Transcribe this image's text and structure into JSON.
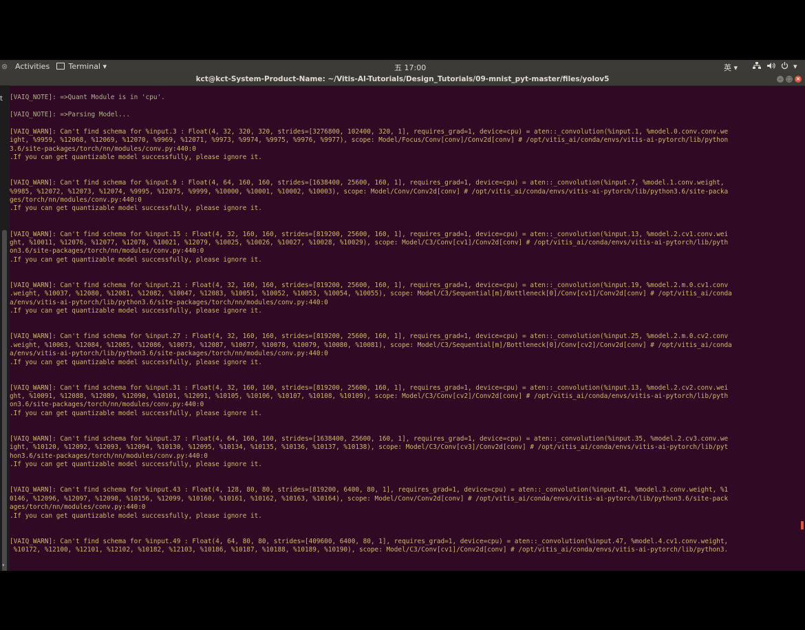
{
  "topbar": {
    "activities": "Activities",
    "app_menu": "Terminal ▾",
    "clock": "五 17:00",
    "input_method": "英 ▾"
  },
  "window": {
    "title": "kct@kct-System-Product-Name: ~/Vitis-AI-Tutorials/Design_Tutorials/09-mnist_pyt-master/files/yolov5"
  },
  "left_glyph": "t",
  "terminal": {
    "lines": [
      {
        "t": "",
        "k": "n"
      },
      {
        "t": "[VAIQ_NOTE]: =>Quant Module is in 'cpu'.",
        "k": "note"
      },
      {
        "t": "",
        "k": "n"
      },
      {
        "t": "[VAIQ_NOTE]: =>Parsing Model...",
        "k": "note"
      },
      {
        "t": "",
        "k": "n"
      },
      {
        "t": "[VAIQ_WARN]: Can't find schema for %input.3 : Float(4, 32, 320, 320, strides=[3276800, 102400, 320, 1], requires_grad=1, device=cpu) = aten::_convolution(%input.1, %model.0.conv.conv.we",
        "k": "warn"
      },
      {
        "t": "ight, %9959, %12068, %12069, %12070, %9969, %12071, %9973, %9974, %9975, %9976, %9977), scope: Model/Focus/Conv[conv]/Conv2d[conv] # /opt/vitis_ai/conda/envs/vitis-ai-pytorch/lib/python",
        "k": "warn"
      },
      {
        "t": "3.6/site-packages/torch/nn/modules/conv.py:440:0",
        "k": "warn"
      },
      {
        "t": ".If you can get quantizable model successfully, please ignore it.",
        "k": "warn"
      },
      {
        "t": "",
        "k": "n"
      },
      {
        "t": "",
        "k": "n"
      },
      {
        "t": "[VAIQ_WARN]: Can't find schema for %input.9 : Float(4, 64, 160, 160, strides=[1638400, 25600, 160, 1], requires_grad=1, device=cpu) = aten::_convolution(%input.7, %model.1.conv.weight,",
        "k": "warn"
      },
      {
        "t": "%9985, %12072, %12073, %12074, %9995, %12075, %9999, %10000, %10001, %10002, %10003), scope: Model/Conv/Conv2d[conv] # /opt/vitis_ai/conda/envs/vitis-ai-pytorch/lib/python3.6/site-packa",
        "k": "warn"
      },
      {
        "t": "ges/torch/nn/modules/conv.py:440:0",
        "k": "warn"
      },
      {
        "t": ".If you can get quantizable model successfully, please ignore it.",
        "k": "warn"
      },
      {
        "t": "",
        "k": "n"
      },
      {
        "t": "",
        "k": "n"
      },
      {
        "t": "[VAIQ_WARN]: Can't find schema for %input.15 : Float(4, 32, 160, 160, strides=[819200, 25600, 160, 1], requires_grad=1, device=cpu) = aten::_convolution(%input.13, %model.2.cv1.conv.wei",
        "k": "warn"
      },
      {
        "t": "ght, %10011, %12076, %12077, %12078, %10021, %12079, %10025, %10026, %10027, %10028, %10029), scope: Model/C3/Conv[cv1]/Conv2d[conv] # /opt/vitis_ai/conda/envs/vitis-ai-pytorch/lib/pyth",
        "k": "warn"
      },
      {
        "t": "on3.6/site-packages/torch/nn/modules/conv.py:440:0",
        "k": "warn"
      },
      {
        "t": ".If you can get quantizable model successfully, please ignore it.",
        "k": "warn"
      },
      {
        "t": "",
        "k": "n"
      },
      {
        "t": "",
        "k": "n"
      },
      {
        "t": "[VAIQ_WARN]: Can't find schema for %input.21 : Float(4, 32, 160, 160, strides=[819200, 25600, 160, 1], requires_grad=1, device=cpu) = aten::_convolution(%input.19, %model.2.m.0.cv1.conv",
        "k": "warn"
      },
      {
        "t": ".weight, %10037, %12080, %12081, %12082, %10047, %12083, %10051, %10052, %10053, %10054, %10055), scope: Model/C3/Sequential[m]/Bottleneck[0]/Conv[cv1]/Conv2d[conv] # /opt/vitis_ai/conda",
        "k": "warn"
      },
      {
        "t": "a/envs/vitis-ai-pytorch/lib/python3.6/site-packages/torch/nn/modules/conv.py:440:0",
        "k": "warn"
      },
      {
        "t": ".If you can get quantizable model successfully, please ignore it.",
        "k": "warn"
      },
      {
        "t": "",
        "k": "n"
      },
      {
        "t": "",
        "k": "n"
      },
      {
        "t": "[VAIQ_WARN]: Can't find schema for %input.27 : Float(4, 32, 160, 160, strides=[819200, 25600, 160, 1], requires_grad=1, device=cpu) = aten::_convolution(%input.25, %model.2.m.0.cv2.conv",
        "k": "warn"
      },
      {
        "t": ".weight, %10063, %12084, %12085, %12086, %10073, %12087, %10077, %10078, %10079, %10080, %10081), scope: Model/C3/Sequential[m]/Bottleneck[0]/Conv[cv2]/Conv2d[conv] # /opt/vitis_ai/conda",
        "k": "warn"
      },
      {
        "t": "a/envs/vitis-ai-pytorch/lib/python3.6/site-packages/torch/nn/modules/conv.py:440:0",
        "k": "warn"
      },
      {
        "t": ".If you can get quantizable model successfully, please ignore it.",
        "k": "warn"
      },
      {
        "t": "",
        "k": "n"
      },
      {
        "t": "",
        "k": "n"
      },
      {
        "t": "[VAIQ_WARN]: Can't find schema for %input.31 : Float(4, 32, 160, 160, strides=[819200, 25600, 160, 1], requires_grad=1, device=cpu) = aten::_convolution(%input.13, %model.2.cv2.conv.wei",
        "k": "warn"
      },
      {
        "t": "ght, %10091, %12088, %12089, %12090, %10101, %12091, %10105, %10106, %10107, %10108, %10109), scope: Model/C3/Conv[cv2]/Conv2d[conv] # /opt/vitis_ai/conda/envs/vitis-ai-pytorch/lib/pyth",
        "k": "warn"
      },
      {
        "t": "on3.6/site-packages/torch/nn/modules/conv.py:440:0",
        "k": "warn"
      },
      {
        "t": ".If you can get quantizable model successfully, please ignore it.",
        "k": "warn"
      },
      {
        "t": "",
        "k": "n"
      },
      {
        "t": "",
        "k": "n"
      },
      {
        "t": "[VAIQ_WARN]: Can't find schema for %input.37 : Float(4, 64, 160, 160, strides=[1638400, 25600, 160, 1], requires_grad=1, device=cpu) = aten::_convolution(%input.35, %model.2.cv3.conv.we",
        "k": "warn"
      },
      {
        "t": "ight, %10120, %12092, %12093, %12094, %10130, %12095, %10134, %10135, %10136, %10137, %10138), scope: Model/C3/Conv[cv3]/Conv2d[conv] # /opt/vitis_ai/conda/envs/vitis-ai-pytorch/lib/pyt",
        "k": "warn"
      },
      {
        "t": "hon3.6/site-packages/torch/nn/modules/conv.py:440:0",
        "k": "warn"
      },
      {
        "t": ".If you can get quantizable model successfully, please ignore it.",
        "k": "warn"
      },
      {
        "t": "",
        "k": "n"
      },
      {
        "t": "",
        "k": "n"
      },
      {
        "t": "[VAIQ_WARN]: Can't find schema for %input.43 : Float(4, 128, 80, 80, strides=[819200, 6400, 80, 1], requires_grad=1, device=cpu) = aten::_convolution(%input.41, %model.3.conv.weight, %1",
        "k": "warn"
      },
      {
        "t": "0146, %12096, %12097, %12098, %10156, %12099, %10160, %10161, %10162, %10163, %10164), scope: Model/Conv/Conv2d[conv] # /opt/vitis_ai/conda/envs/vitis-ai-pytorch/lib/python3.6/site-pack",
        "k": "warn"
      },
      {
        "t": "ages/torch/nn/modules/conv.py:440:0",
        "k": "warn"
      },
      {
        "t": ".If you can get quantizable model successfully, please ignore it.",
        "k": "warn"
      },
      {
        "t": "",
        "k": "n"
      },
      {
        "t": "",
        "k": "n"
      },
      {
        "t": "[VAIQ_WARN]: Can't find schema for %input.49 : Float(4, 64, 80, 80, strides=[409600, 6400, 80, 1], requires_grad=1, device=cpu) = aten::_convolution(%input.47, %model.4.cv1.conv.weight,",
        "k": "warn"
      },
      {
        "t": " %10172, %12100, %12101, %12102, %10182, %12103, %10186, %10187, %10188, %10189, %10190), scope: Model/C3/Conv[cv1]/Conv2d[conv] # /opt/vitis_ai/conda/envs/vitis-ai-pytorch/lib/python3.",
        "k": "warn"
      }
    ]
  }
}
